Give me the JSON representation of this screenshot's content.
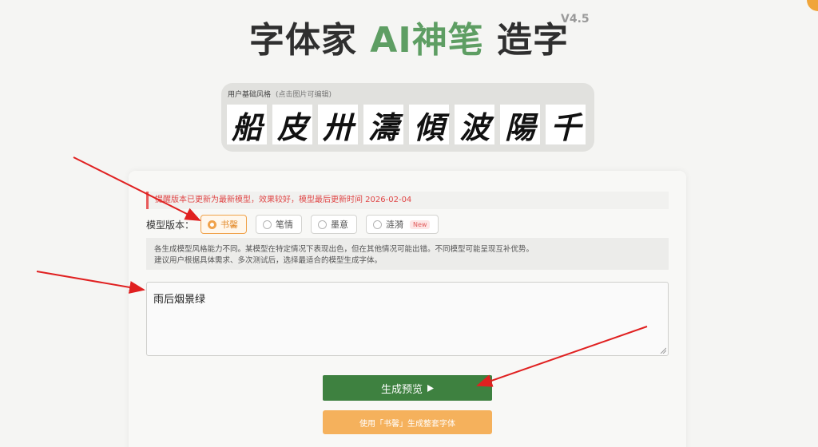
{
  "header": {
    "title_part1": "字体家 ",
    "title_accent": "AI神笔",
    "title_part2": " 造字",
    "version": "V4.5"
  },
  "style_panel": {
    "label": "用户基础风格",
    "hint": "(点击图片可编辑)",
    "glyphs": [
      "船",
      "皮",
      "卅",
      "濤",
      "傾",
      "波",
      "陽",
      "千"
    ]
  },
  "notice": "提醒版本已更新为最新模型，效果较好，模型最后更新时间 2026-02-04",
  "model": {
    "label": "模型版本：",
    "options": [
      {
        "label": "书馨",
        "selected": true
      },
      {
        "label": "笔情",
        "selected": false
      },
      {
        "label": "墨意",
        "selected": false
      },
      {
        "label": "涟漪",
        "selected": false,
        "badge": "New"
      }
    ]
  },
  "description": {
    "line1": "各生成模型风格能力不同。某模型在特定情况下表现出色，但在其他情况可能出错。不同模型可能呈现互补优势。",
    "line2": "建议用户根据具体需求、多次测试后，选择最适合的模型生成字体。"
  },
  "input_text": "雨后烟景绿",
  "buttons": {
    "preview": "生成预览",
    "preview_icon": "play-triangle-icon",
    "generate_full": "使用「书馨」生成整套字体"
  },
  "colors": {
    "accent_green": "#5e9e63",
    "button_green": "#3e8140",
    "button_orange": "#f5b15c",
    "selected_orange": "#f0a24a",
    "notice_red": "#e04646",
    "annotation_red": "#e02020"
  }
}
